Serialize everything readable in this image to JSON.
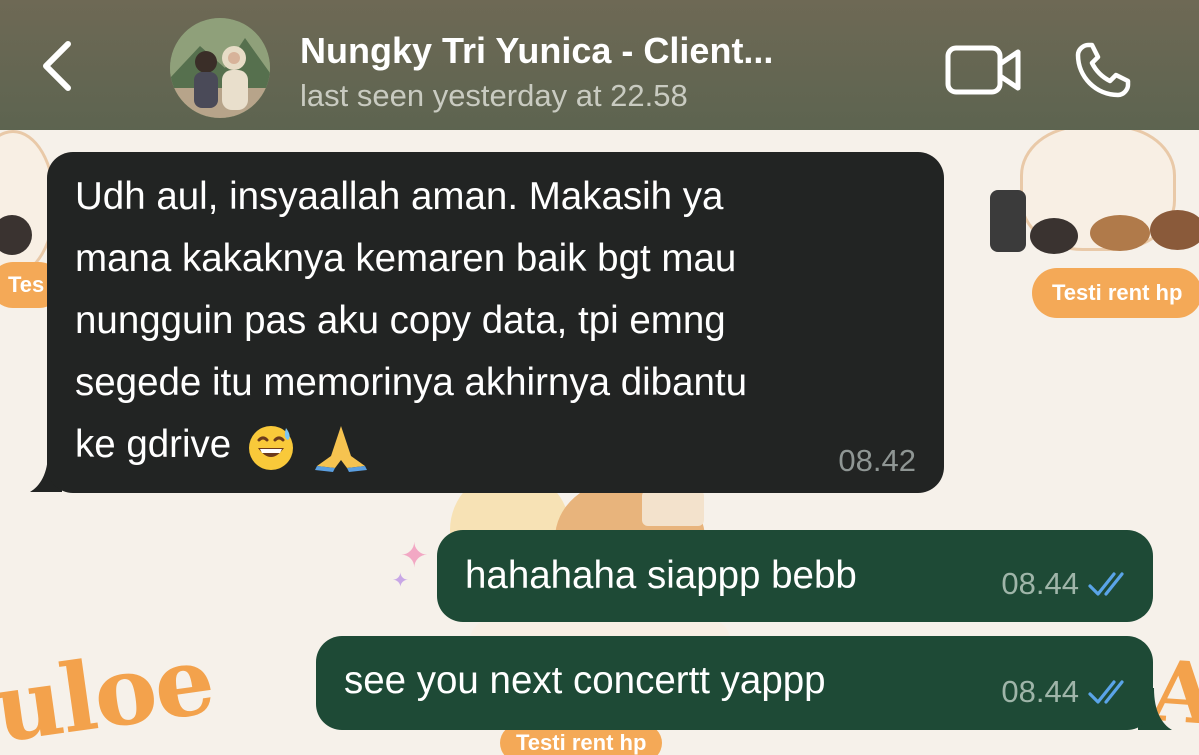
{
  "header": {
    "back_icon": "chevron-left-icon",
    "contact_name": "Nungky Tri Yunica - Client...",
    "status": "last seen yesterday at 22.58",
    "video_icon": "video-camera-icon",
    "call_icon": "phone-icon"
  },
  "wallpaper": {
    "tags": [
      "Tes",
      "Testi rent hp",
      "Testi rent hp"
    ],
    "logo_text": "uloe",
    "logo_text_2": "Aulo"
  },
  "messages": [
    {
      "direction": "incoming",
      "lines": [
        "Udh aul, insyaallah aman. Makasih ya",
        "mana kakaknya kemaren baik bgt mau",
        "nungguin pas aku copy data, tpi emng",
        "segede itu memorinya akhirnya dibantu",
        "ke gdrive"
      ],
      "emoji": [
        "grinning-sweat-emoji",
        "folded-hands-emoji"
      ],
      "time": "08.42"
    },
    {
      "direction": "outgoing",
      "text": "hahahaha siappp bebb",
      "time": "08.44",
      "status_icon": "double-check-read-icon"
    },
    {
      "direction": "outgoing",
      "text": "see you next concertt yappp",
      "time": "08.44",
      "status_icon": "double-check-read-icon"
    }
  ],
  "colors": {
    "header_bg": "#656651",
    "incoming_bubble": "#222423",
    "outgoing_bubble": "#1e4a36",
    "read_ticks": "#5aa4e8",
    "wallpaper_accent": "#f4a957"
  }
}
